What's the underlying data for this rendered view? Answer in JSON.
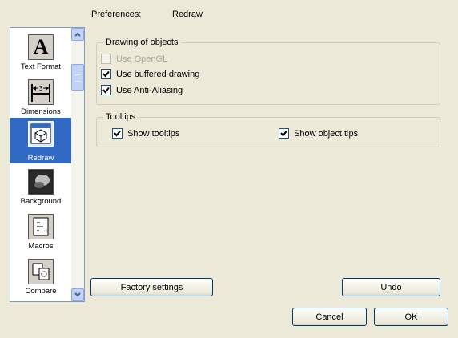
{
  "header": {
    "label": "Preferences:",
    "value": "Redraw"
  },
  "sidebar": {
    "items": [
      {
        "label": "Text Format",
        "icon": "text-format-icon"
      },
      {
        "label": "Dimensions",
        "icon": "dimensions-icon"
      },
      {
        "label": "Redraw",
        "icon": "redraw-icon",
        "selected": true
      },
      {
        "label": "Background",
        "icon": "background-icon"
      },
      {
        "label": "Macros",
        "icon": "macros-icon"
      },
      {
        "label": "Compare",
        "icon": "compare-icon"
      }
    ]
  },
  "drawing": {
    "title": "Drawing of objects",
    "use_opengl": {
      "label": "Use OpenGL",
      "checked": false,
      "disabled": true
    },
    "buffered": {
      "label": "Use buffered drawing",
      "checked": true
    },
    "antialias": {
      "label": "Use Anti-Aliasing",
      "checked": true
    }
  },
  "tooltips": {
    "title": "Tooltips",
    "show_tooltips": {
      "label": "Show tooltips",
      "checked": true
    },
    "show_object_tips": {
      "label": "Show object tips",
      "checked": true
    }
  },
  "buttons": {
    "factory": "Factory settings",
    "undo": "Undo",
    "cancel": "Cancel",
    "ok": "OK"
  },
  "colors": {
    "selection": "#316ac5",
    "background": "#ece9d8"
  }
}
